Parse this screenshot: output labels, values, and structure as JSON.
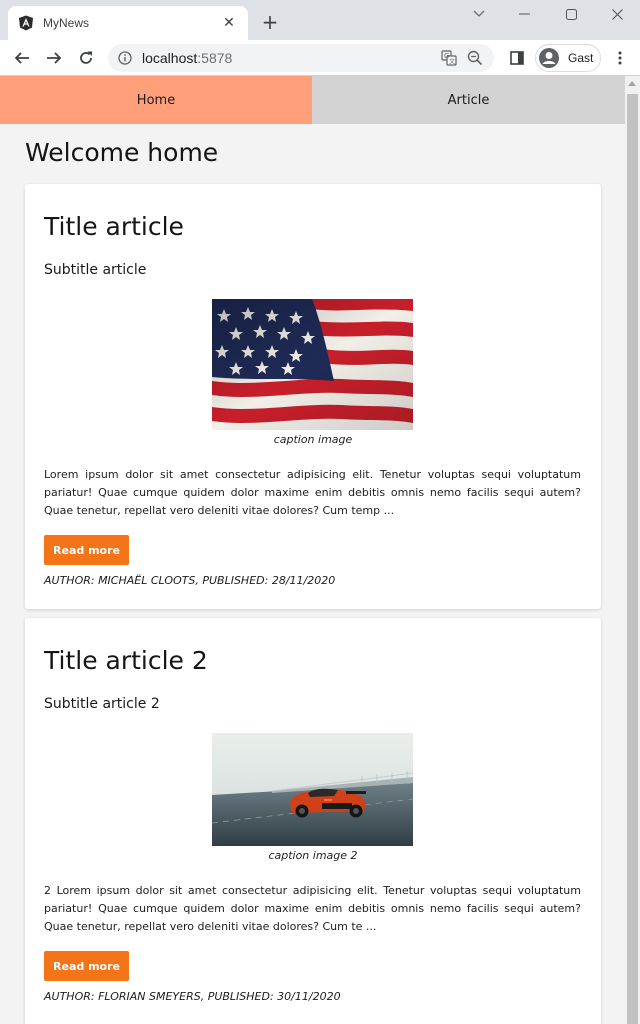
{
  "browser": {
    "tab_title": "MyNews",
    "url_host": "localhost",
    "url_port": ":5878",
    "profile_label": "Gast"
  },
  "nav": {
    "items": [
      {
        "label": "Home",
        "active": true,
        "color": "#ffa07a"
      },
      {
        "label": "Article",
        "active": false,
        "color": "#d3d3d3"
      }
    ]
  },
  "page": {
    "title": "Welcome home"
  },
  "articles": [
    {
      "title": "Title article",
      "subtitle": "Subtitle article",
      "image": "us-flag-image",
      "caption": "caption image",
      "body": "Lorem ipsum dolor sit amet consectetur adipisicing elit. Tenetur voluptas sequi voluptatum pariatur! Quae cumque quidem dolor maxime enim debitis omnis nemo facilis sequi autem? Quae tenetur, repellat vero deleniti vitae dolores? Cum temp ...",
      "button_label": "Read more",
      "meta": "AUTHOR: MICHAËL CLOOTS, PUBLISHED: 28/11/2020"
    },
    {
      "title": "Title article 2",
      "subtitle": "Subtitle article 2",
      "image": "sports-car-image",
      "caption": "caption image 2",
      "body": "2 Lorem ipsum dolor sit amet consectetur adipisicing elit. Tenetur voluptas sequi voluptatum pariatur! Quae cumque quidem dolor maxime enim debitis omnis nemo facilis sequi autem? Quae tenetur, repellat vero deleniti vitae dolores? Cum te ...",
      "button_label": "Read more",
      "meta": "AUTHOR: FLORIAN SMEYERS, PUBLISHED: 30/11/2020"
    }
  ],
  "colors": {
    "accent_button": "#f47517",
    "nav_active": "#ffa07a",
    "nav_inactive": "#d3d3d3"
  }
}
